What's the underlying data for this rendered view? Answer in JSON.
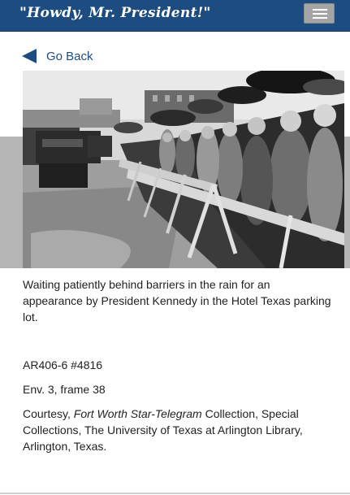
{
  "header": {
    "brand_title": "\"Howdy, Mr. President!\"",
    "menu_icon": "hamburger-icon",
    "colors": {
      "bar": "#1d4d80",
      "menu_button": "#a5a5a5"
    }
  },
  "nav": {
    "back_label": "Go Back",
    "back_icon": "triangle-left-icon"
  },
  "photo": {
    "subject": "Crowd behind wooden barriers in the rain, holding umbrellas, Hotel Texas parking lot"
  },
  "record": {
    "caption": "Waiting patiently behind barriers in the rain for an appearance by President Kennedy in the Hotel Texas parking lot.",
    "call_number": "AR406-6 #4816",
    "frame": "Env. 3, frame 38",
    "credit_prefix": "Courtesy, ",
    "credit_collection": "Fort Worth Star-Telegram",
    "credit_suffix": " Collection, Special Collections, The University of Texas at Arlington Library, Arlington, Texas."
  }
}
